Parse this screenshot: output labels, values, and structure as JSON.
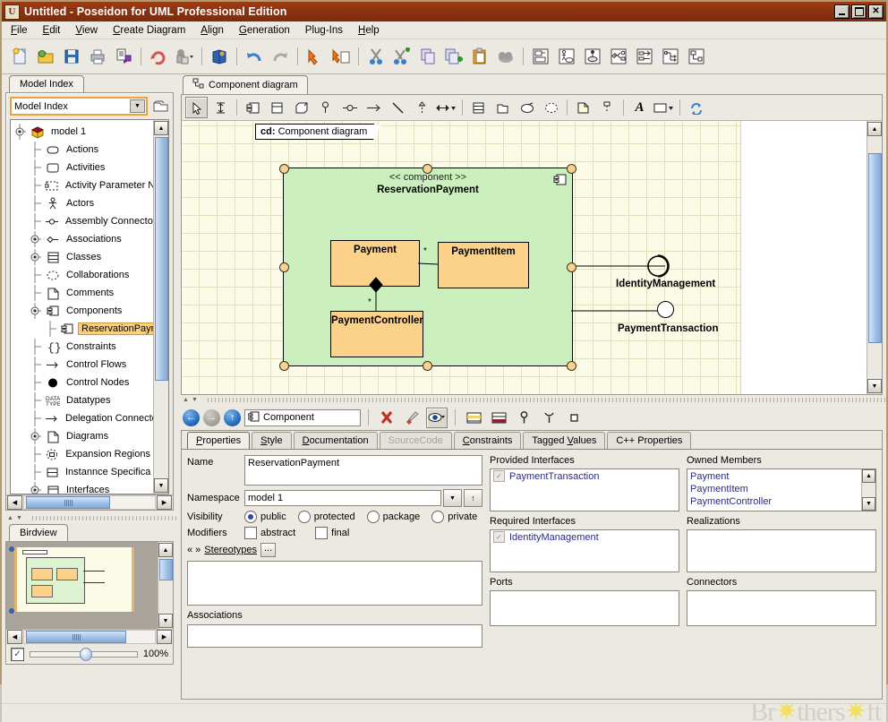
{
  "window": {
    "title": "Untitled - Poseidon for UML Professional Edition",
    "logo_glyph": "U",
    "minimize": "_",
    "maximize": "□",
    "close": "✕"
  },
  "menubar": {
    "items": [
      {
        "label": "File",
        "accel": "F"
      },
      {
        "label": "Edit",
        "accel": "E"
      },
      {
        "label": "View",
        "accel": "V"
      },
      {
        "label": "Create Diagram",
        "accel": "C"
      },
      {
        "label": "Align",
        "accel": "A"
      },
      {
        "label": "Generation",
        "accel": "G"
      },
      {
        "label": "Plug-Ins",
        "accel": "P"
      },
      {
        "label": "Help",
        "accel": "H"
      }
    ]
  },
  "toolbar": {
    "buttons": [
      {
        "name": "new-file-icon",
        "title": "New"
      },
      {
        "name": "open-folder-icon",
        "title": "Open"
      },
      {
        "name": "save-icon",
        "title": "Save"
      },
      {
        "name": "print-icon",
        "title": "Print"
      },
      {
        "name": "export-icon",
        "title": "Export"
      },
      {
        "name": "refresh-icon",
        "title": "Refresh"
      },
      {
        "name": "group-dropdown-icon",
        "title": "Group"
      },
      {
        "name": "book-icon",
        "title": "Documentation"
      },
      {
        "name": "undo-icon",
        "title": "Undo"
      },
      {
        "name": "redo-icon",
        "title": "Redo"
      },
      {
        "name": "delete-arrow-icon",
        "title": "Delete"
      },
      {
        "name": "delete-file-icon",
        "title": "Delete from model"
      },
      {
        "name": "cut-icon",
        "title": "Cut"
      },
      {
        "name": "cut-add-icon",
        "title": "Cut and add"
      },
      {
        "name": "copy-icon",
        "title": "Copy"
      },
      {
        "name": "copy-add-icon",
        "title": "Copy and add"
      },
      {
        "name": "paste-icon",
        "title": "Paste"
      },
      {
        "name": "cloud-icon",
        "title": "Cloud"
      },
      {
        "name": "class-diagram-icon",
        "title": "Class diagram"
      },
      {
        "name": "usecase-diagram-icon",
        "title": "Use case diagram"
      },
      {
        "name": "deployment-diagram-icon",
        "title": "Deployment diagram"
      },
      {
        "name": "statechart-diagram-icon",
        "title": "Statechart diagram"
      },
      {
        "name": "sequence-diagram-icon",
        "title": "Sequence diagram"
      },
      {
        "name": "activity-diagram-icon",
        "title": "Activity diagram"
      },
      {
        "name": "component-diagram-icon",
        "title": "Component diagram"
      }
    ]
  },
  "model_index": {
    "tab_label": "Model Index",
    "combo_value": "Model Index",
    "folder_icon": "folder-icon",
    "tree": [
      {
        "label": "model 1",
        "depth": 0,
        "icon": "model-cube-icon",
        "knob": "expanded",
        "selected": false
      },
      {
        "label": "Actions",
        "depth": 1,
        "icon": "action-rounded-icon",
        "knob": "leaf",
        "selected": false
      },
      {
        "label": "Activities",
        "depth": 1,
        "icon": "activity-icon",
        "knob": "leaf",
        "selected": false
      },
      {
        "label": "Activity Parameter N",
        "depth": 1,
        "icon": "activity-parameter-node-icon",
        "knob": "leaf",
        "selected": false
      },
      {
        "label": "Actors",
        "depth": 1,
        "icon": "actor-icon",
        "knob": "leaf",
        "selected": false
      },
      {
        "label": "Assembly Connector",
        "depth": 1,
        "icon": "assembly-connector-icon",
        "knob": "leaf",
        "selected": false
      },
      {
        "label": "Associations",
        "depth": 1,
        "icon": "association-icon",
        "knob": "collapsed",
        "selected": false
      },
      {
        "label": "Classes",
        "depth": 1,
        "icon": "class-icon",
        "knob": "collapsed",
        "selected": false
      },
      {
        "label": "Collaborations",
        "depth": 1,
        "icon": "collaboration-icon",
        "knob": "leaf",
        "selected": false
      },
      {
        "label": "Comments",
        "depth": 1,
        "icon": "comment-icon",
        "knob": "leaf",
        "selected": false
      },
      {
        "label": "Components",
        "depth": 1,
        "icon": "component-icon",
        "knob": "expanded",
        "selected": false
      },
      {
        "label": "ReservationPaym",
        "depth": 2,
        "icon": "component-icon",
        "knob": "leaf",
        "selected": true
      },
      {
        "label": "Constraints",
        "depth": 1,
        "icon": "constraint-braces-icon",
        "knob": "leaf",
        "selected": false
      },
      {
        "label": "Control Flows",
        "depth": 1,
        "icon": "control-flow-arrow-icon",
        "knob": "leaf",
        "selected": false
      },
      {
        "label": "Control Nodes",
        "depth": 1,
        "icon": "control-node-icon",
        "knob": "leaf",
        "selected": false
      },
      {
        "label": "Datatypes",
        "depth": 1,
        "icon": "datatype-icon",
        "knob": "leaf",
        "selected": false
      },
      {
        "label": "Delegation Connector",
        "depth": 1,
        "icon": "delegation-connector-icon",
        "knob": "leaf",
        "selected": false
      },
      {
        "label": "Diagrams",
        "depth": 1,
        "icon": "diagram-icon",
        "knob": "collapsed",
        "selected": false
      },
      {
        "label": "Expansion Regions",
        "depth": 1,
        "icon": "expansion-region-icon",
        "knob": "leaf",
        "selected": false
      },
      {
        "label": "Instannce Specifica",
        "depth": 1,
        "icon": "instance-specification-icon",
        "knob": "leaf",
        "selected": false
      },
      {
        "label": "Interfaces",
        "depth": 1,
        "icon": "interface-icon",
        "knob": "collapsed",
        "selected": false
      }
    ]
  },
  "birdview": {
    "tab_label": "Birdview",
    "zoom_label": "100%",
    "zoom_checked": true
  },
  "diagram": {
    "tab_label": "Component diagram",
    "tab_icon": "component-diagram-icon",
    "toolbar": [
      {
        "name": "select-pointer-icon",
        "title": "Select",
        "active": true
      },
      {
        "name": "resize-icon",
        "title": "Resize",
        "active": false
      },
      {
        "name": "component-tool-icon",
        "title": "Component",
        "active": false
      },
      {
        "name": "interface-tool-icon",
        "title": "Interface",
        "active": false
      },
      {
        "name": "node-tool-icon",
        "title": "Node",
        "active": false
      },
      {
        "name": "provided-interface-icon",
        "title": "Provided interface",
        "active": false
      },
      {
        "name": "assembly-connector-tool-icon",
        "title": "Assembly connector",
        "active": false
      },
      {
        "name": "dependency-arrow-icon",
        "title": "Dependency",
        "active": false
      },
      {
        "name": "association-line-icon",
        "title": "Association",
        "active": false
      },
      {
        "name": "generalization-icon",
        "title": "Generalization",
        "active": false
      },
      {
        "name": "navigable-association-dropdown-icon",
        "title": "Navigable association",
        "active": false
      },
      {
        "name": "class-tool-icon",
        "title": "Class",
        "active": false
      },
      {
        "name": "package-tool-icon",
        "title": "Package",
        "active": false
      },
      {
        "name": "usecase-tool-icon",
        "title": "Use case",
        "active": false
      },
      {
        "name": "collaboration-tool-icon",
        "title": "Collaboration",
        "active": false
      },
      {
        "name": "note-tool-icon",
        "title": "Note",
        "active": false
      },
      {
        "name": "note-anchor-icon",
        "title": "Note anchor",
        "active": false
      },
      {
        "name": "text-tool-icon",
        "title": "Text",
        "active": false
      },
      {
        "name": "shape-dropdown-icon",
        "title": "Shape",
        "active": false
      },
      {
        "name": "refresh-diagram-icon",
        "title": "Refresh",
        "active": false
      }
    ],
    "note_prefix": "cd:",
    "note_text": "Component diagram",
    "component": {
      "stereotype": "<< component >>",
      "name": "ReservationPayment",
      "fill": "#ccf0bd"
    },
    "classes": [
      {
        "name": "Payment",
        "fill": "#fcd189"
      },
      {
        "name": "PaymentItem",
        "fill": "#fcd189"
      },
      {
        "name": "PaymentController",
        "fill": "#fcd189"
      }
    ],
    "multiplicities": [
      "*",
      "*"
    ],
    "interfaces": [
      {
        "name": "IdentityManagement",
        "kind": "required-socket"
      },
      {
        "name": "PaymentTransaction",
        "kind": "provided-ball"
      }
    ]
  },
  "properties_bar": {
    "back_icon": "back-arrow-icon",
    "forward_icon": "forward-arrow-icon",
    "up_icon": "up-arrow-icon",
    "element_icon": "component-icon",
    "element_label": "Component",
    "delete_icon": "delete-x-icon",
    "brush_icon": "brush-icon",
    "eye_icon": "visibility-eye-icon",
    "attrs_icon": "show-attributes-icon",
    "ops_icon": "show-operations-icon",
    "provided_icon": "provided-interface-icon",
    "required_icon": "required-interface-icon",
    "port_icon": "port-icon"
  },
  "properties": {
    "tabs": [
      {
        "label": "Properties",
        "accel": "P",
        "active": true,
        "disabled": false
      },
      {
        "label": "Style",
        "accel": "S",
        "active": false,
        "disabled": false
      },
      {
        "label": "Documentation",
        "accel": "D",
        "active": false,
        "disabled": false
      },
      {
        "label": "SourceCode",
        "accel": "",
        "active": false,
        "disabled": true
      },
      {
        "label": "Constraints",
        "accel": "C",
        "active": false,
        "disabled": false
      },
      {
        "label": "Tagged Values",
        "accel": "V",
        "active": false,
        "disabled": false
      },
      {
        "label": "C++ Properties",
        "accel": "",
        "active": false,
        "disabled": false
      }
    ],
    "name_label": "Name",
    "name_value": "ReservationPayment",
    "namespace_label": "Namespace",
    "namespace_value": "model 1",
    "visibility_label": "Visibility",
    "visibility_options": [
      {
        "label": "public",
        "checked": true
      },
      {
        "label": "protected",
        "checked": false
      },
      {
        "label": "package",
        "checked": false
      },
      {
        "label": "private",
        "checked": false
      }
    ],
    "modifiers_label": "Modifiers",
    "modifier_options": [
      {
        "label": "abstract",
        "checked": false
      },
      {
        "label": "final",
        "checked": false
      }
    ],
    "stereotypes_label": "Stereotypes",
    "stereotypes_guillemets": "« »",
    "stereotypes_button": "...",
    "associations_label": "Associations",
    "associations_value": "",
    "provided_interfaces_label": "Provided Interfaces",
    "provided_interfaces": [
      "PaymentTransaction"
    ],
    "required_interfaces_label": "Required Interfaces",
    "required_interfaces": [
      "IdentityManagement"
    ],
    "ports_label": "Ports",
    "ports": [],
    "owned_members_label": "Owned Members",
    "owned_members": [
      "Payment",
      "PaymentItem",
      "PaymentController"
    ],
    "realizations_label": "Realizations",
    "realizations": [],
    "connectors_label": "Connectors",
    "connectors": []
  },
  "statusbar": {
    "watermark_left": "Br",
    "watermark_star1": "✷",
    "watermark_mid": "thers",
    "watermark_star2": "✷",
    "watermark_right": "ft"
  }
}
